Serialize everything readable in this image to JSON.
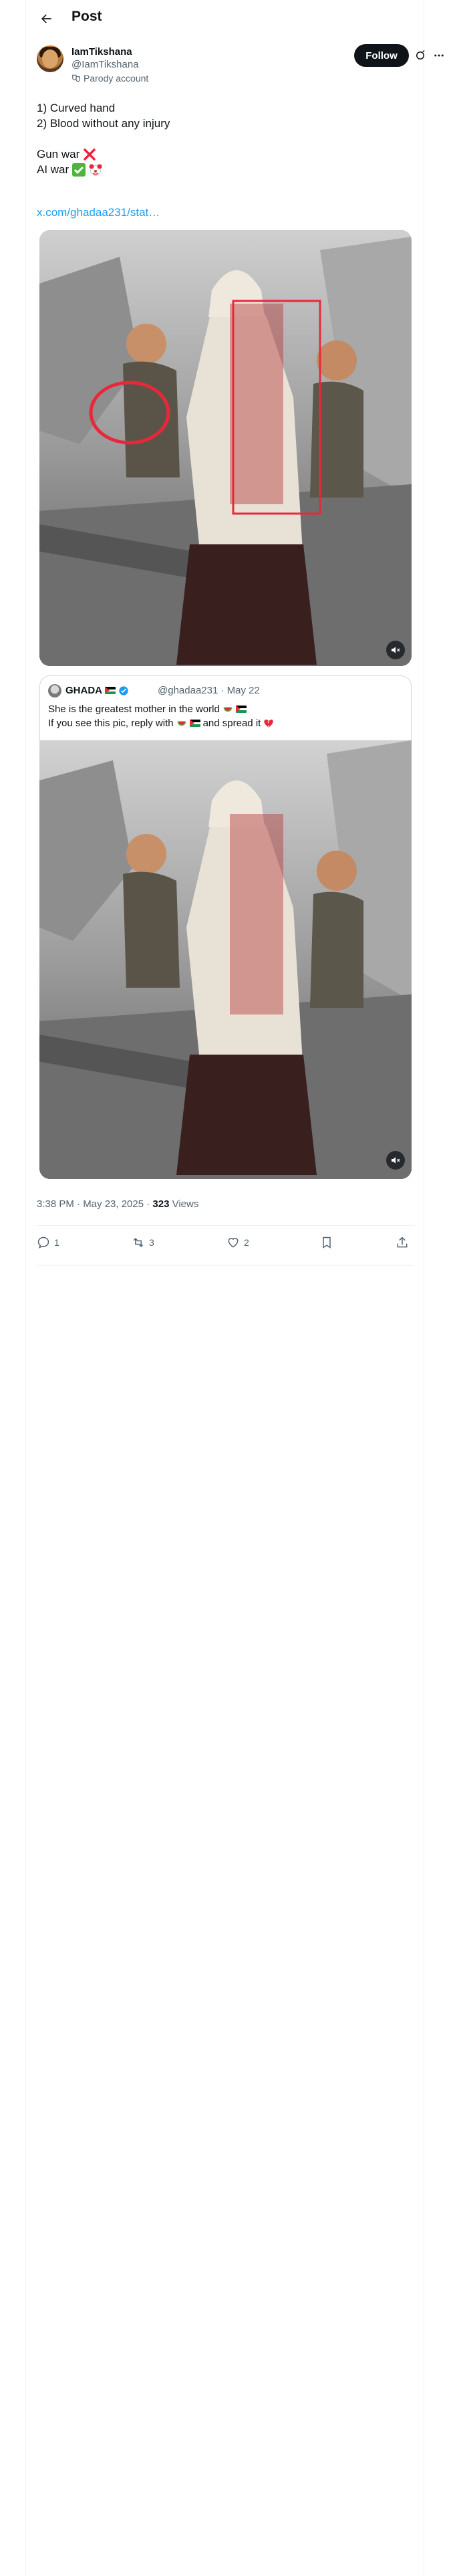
{
  "header": {
    "title": "Post"
  },
  "author": {
    "display_name": "IamTikshana",
    "handle": "@IamTikshana",
    "badge": "Parody account",
    "follow_label": "Follow"
  },
  "tweet": {
    "lines": [
      "1) Curved hand",
      "2) Blood without any injury",
      "Gun war",
      "AI war"
    ],
    "link": "x.com/ghadaa231/stat…"
  },
  "quoted": {
    "name": "GHADA",
    "handle_date": "@ghadaa231 · May 22",
    "line1": "She is the greatest mother in the world",
    "line2_prefix": "If you see this pic, reply with",
    "line2_suffix": "and spread it"
  },
  "meta": {
    "time_date": "3:38 PM · May 23, 2025 · ",
    "views_count": "323",
    "views_label": " Views"
  },
  "actions": {
    "replies": "1",
    "reposts": "3",
    "likes": "2"
  },
  "colors": {
    "accent": "#1d9bf0",
    "text": "#0f1419",
    "muted": "#536471",
    "annotation": "#e8283a"
  }
}
